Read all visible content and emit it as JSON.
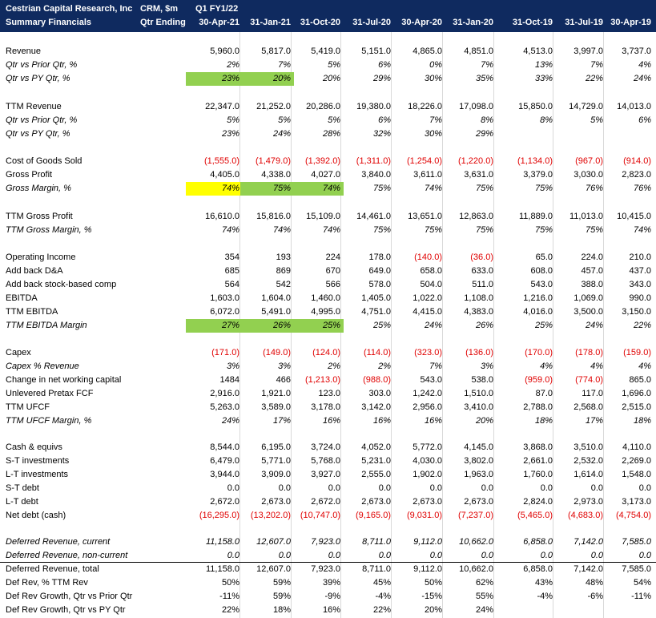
{
  "header": {
    "company": "Cestrian Capital Research, Inc",
    "subtitle": "Summary Financials",
    "units": "CRM, $m",
    "units2": "Qtr Ending",
    "q1_label": "Q1 FY1/22",
    "periods": [
      "30-Apr-21",
      "31-Jan-21",
      "31-Oct-20",
      "31-Jul-20",
      "30-Apr-20",
      "31-Jan-20",
      "31-Oct-19",
      "31-Jul-19",
      "30-Apr-19"
    ]
  },
  "rows": [
    {
      "label": "Revenue",
      "italic": false,
      "values": [
        "5,960.0",
        "5,817.0",
        "5,419.0",
        "5,151.0",
        "4,865.0",
        "4,851.0",
        "4,513.0",
        "3,997.0",
        "3,737.0"
      ]
    },
    {
      "label": "Qtr vs Prior Qtr, %",
      "italic": true,
      "values": [
        "2%",
        "7%",
        "5%",
        "6%",
        "0%",
        "7%",
        "13%",
        "7%",
        "4%"
      ]
    },
    {
      "label": "Qtr vs PY Qtr, %",
      "italic": true,
      "values": [
        "23%",
        "20%",
        "20%",
        "29%",
        "30%",
        "35%",
        "33%",
        "22%",
        "24%"
      ]
    },
    {
      "label": "TTM Revenue",
      "italic": false,
      "values": [
        "22,347.0",
        "21,252.0",
        "20,286.0",
        "19,380.0",
        "18,226.0",
        "17,098.0",
        "15,850.0",
        "14,729.0",
        "14,013.0"
      ]
    },
    {
      "label": "Qtr vs Prior Qtr, %",
      "italic": true,
      "values": [
        "5%",
        "5%",
        "5%",
        "6%",
        "7%",
        "8%",
        "8%",
        "5%",
        "6%"
      ]
    },
    {
      "label": "Qtr vs PY Qtr, %",
      "italic": true,
      "values": [
        "23%",
        "24%",
        "28%",
        "32%",
        "30%",
        "29%",
        "",
        "",
        ""
      ]
    },
    {
      "label": "Cost of Goods Sold",
      "italic": false,
      "values": [
        "(1,555.0)",
        "(1,479.0)",
        "(1,392.0)",
        "(1,311.0)",
        "(1,254.0)",
        "(1,220.0)",
        "(1,134.0)",
        "(967.0)",
        "(914.0)"
      ]
    },
    {
      "label": "Gross Profit",
      "italic": false,
      "values": [
        "4,405.0",
        "4,338.0",
        "4,027.0",
        "3,840.0",
        "3,611.0",
        "3,631.0",
        "3,379.0",
        "3,030.0",
        "2,823.0"
      ]
    },
    {
      "label": "Gross Margin, %",
      "italic": true,
      "values": [
        "74%",
        "75%",
        "74%",
        "75%",
        "74%",
        "75%",
        "75%",
        "76%",
        "76%"
      ]
    },
    {
      "label": "TTM Gross Profit",
      "italic": false,
      "values": [
        "16,610.0",
        "15,816.0",
        "15,109.0",
        "14,461.0",
        "13,651.0",
        "12,863.0",
        "11,889.0",
        "11,013.0",
        "10,415.0"
      ]
    },
    {
      "label": "TTM Gross Margin, %",
      "italic": true,
      "values": [
        "74%",
        "74%",
        "74%",
        "75%",
        "75%",
        "75%",
        "75%",
        "75%",
        "74%"
      ]
    },
    {
      "label": "Operating Income",
      "italic": false,
      "values": [
        "354",
        "193",
        "224",
        "178.0",
        "(140.0)",
        "(36.0)",
        "65.0",
        "224.0",
        "210.0"
      ]
    },
    {
      "label": "Add back D&A",
      "italic": false,
      "values": [
        "685",
        "869",
        "670",
        "649.0",
        "658.0",
        "633.0",
        "608.0",
        "457.0",
        "437.0"
      ]
    },
    {
      "label": "Add back stock-based comp",
      "italic": false,
      "values": [
        "564",
        "542",
        "566",
        "578.0",
        "504.0",
        "511.0",
        "543.0",
        "388.0",
        "343.0"
      ]
    },
    {
      "label": "EBITDA",
      "italic": false,
      "values": [
        "1,603.0",
        "1,604.0",
        "1,460.0",
        "1,405.0",
        "1,022.0",
        "1,108.0",
        "1,216.0",
        "1,069.0",
        "990.0"
      ]
    },
    {
      "label": "TTM EBITDA",
      "italic": false,
      "values": [
        "6,072.0",
        "5,491.0",
        "4,995.0",
        "4,751.0",
        "4,415.0",
        "4,383.0",
        "4,016.0",
        "3,500.0",
        "3,150.0"
      ]
    },
    {
      "label": "TTM EBITDA Margin",
      "italic": true,
      "values": [
        "27%",
        "26%",
        "25%",
        "25%",
        "24%",
        "26%",
        "25%",
        "24%",
        "22%"
      ]
    },
    {
      "label": "Capex",
      "italic": false,
      "values": [
        "(171.0)",
        "(149.0)",
        "(124.0)",
        "(114.0)",
        "(323.0)",
        "(136.0)",
        "(170.0)",
        "(178.0)",
        "(159.0)"
      ]
    },
    {
      "label": "Capex % Revenue",
      "italic": true,
      "values": [
        "3%",
        "3%",
        "2%",
        "2%",
        "7%",
        "3%",
        "4%",
        "4%",
        "4%"
      ]
    },
    {
      "label": "Change in net working capital",
      "italic": false,
      "values": [
        "1484",
        "466",
        "(1,213.0)",
        "(988.0)",
        "543.0",
        "538.0",
        "(959.0)",
        "(774.0)",
        "865.0"
      ]
    },
    {
      "label": "Unlevered Pretax FCF",
      "italic": false,
      "values": [
        "2,916.0",
        "1,921.0",
        "123.0",
        "303.0",
        "1,242.0",
        "1,510.0",
        "87.0",
        "117.0",
        "1,696.0"
      ]
    },
    {
      "label": "TTM UFCF",
      "italic": false,
      "values": [
        "5,263.0",
        "3,589.0",
        "3,178.0",
        "3,142.0",
        "2,956.0",
        "3,410.0",
        "2,788.0",
        "2,568.0",
        "2,515.0"
      ]
    },
    {
      "label": "TTM UFCF Margin, %",
      "italic": true,
      "values": [
        "24%",
        "17%",
        "16%",
        "16%",
        "16%",
        "20%",
        "18%",
        "17%",
        "18%"
      ]
    },
    {
      "label": "Cash & equivs",
      "italic": false,
      "values": [
        "8,544.0",
        "6,195.0",
        "3,724.0",
        "4,052.0",
        "5,772.0",
        "4,145.0",
        "3,868.0",
        "3,510.0",
        "4,110.0"
      ]
    },
    {
      "label": "S-T investments",
      "italic": false,
      "values": [
        "6,479.0",
        "5,771.0",
        "5,768.0",
        "5,231.0",
        "4,030.0",
        "3,802.0",
        "2,661.0",
        "2,532.0",
        "2,269.0"
      ]
    },
    {
      "label": "L-T investments",
      "italic": false,
      "values": [
        "3,944.0",
        "3,909.0",
        "3,927.0",
        "2,555.0",
        "1,902.0",
        "1,963.0",
        "1,760.0",
        "1,614.0",
        "1,548.0"
      ]
    },
    {
      "label": "S-T debt",
      "italic": false,
      "values": [
        "0.0",
        "0.0",
        "0.0",
        "0.0",
        "0.0",
        "0.0",
        "0.0",
        "0.0",
        "0.0"
      ]
    },
    {
      "label": "L-T debt",
      "italic": false,
      "values": [
        "2,672.0",
        "2,673.0",
        "2,672.0",
        "2,673.0",
        "2,673.0",
        "2,673.0",
        "2,824.0",
        "2,973.0",
        "3,173.0"
      ]
    },
    {
      "label": "Net debt (cash)",
      "italic": false,
      "values": [
        "(16,295.0)",
        "(13,202.0)",
        "(10,747.0)",
        "(9,165.0)",
        "(9,031.0)",
        "(7,237.0)",
        "(5,465.0)",
        "(4,683.0)",
        "(4,754.0)"
      ]
    },
    {
      "label": "Deferred Revenue, current",
      "italic": true,
      "values": [
        "11,158.0",
        "12,607.0",
        "7,923.0",
        "8,711.0",
        "9,112.0",
        "10,662.0",
        "6,858.0",
        "7,142.0",
        "7,585.0"
      ]
    },
    {
      "label": "Deferred Revenue, non-current",
      "italic": true,
      "values": [
        "0.0",
        "0.0",
        "0.0",
        "0.0",
        "0.0",
        "0.0",
        "0.0",
        "0.0",
        "0.0"
      ]
    },
    {
      "label": "Deferred Revenue, total",
      "italic": false,
      "values": [
        "11,158.0",
        "12,607.0",
        "7,923.0",
        "8,711.0",
        "9,112.0",
        "10,662.0",
        "6,858.0",
        "7,142.0",
        "7,585.0"
      ]
    },
    {
      "label": "Def Rev, % TTM Rev",
      "italic": false,
      "values": [
        "50%",
        "59%",
        "39%",
        "45%",
        "50%",
        "62%",
        "43%",
        "48%",
        "54%"
      ]
    },
    {
      "label": "Def Rev Growth, Qtr vs Prior Qtr",
      "italic": false,
      "values": [
        "-11%",
        "59%",
        "-9%",
        "-4%",
        "-15%",
        "55%",
        "-4%",
        "-6%",
        "-11%"
      ]
    },
    {
      "label": "Def Rev Growth, Qtr vs PY Qtr",
      "italic": false,
      "values": [
        "22%",
        "18%",
        "16%",
        "22%",
        "20%",
        "24%",
        "",
        "",
        ""
      ]
    }
  ],
  "colors": {
    "header_bg": "#0f2a5f",
    "negative": "#e00000",
    "highlight_green": "#92d050",
    "highlight_yellow": "#ffff00"
  }
}
